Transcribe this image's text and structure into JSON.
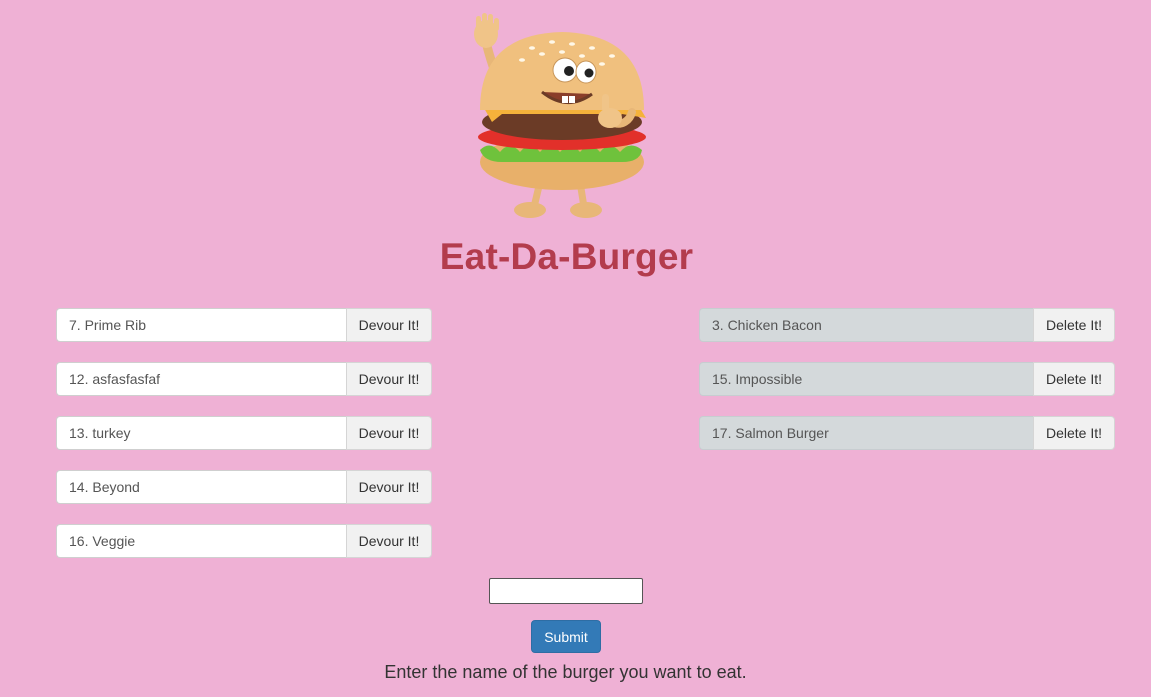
{
  "header": {
    "title": "Eat-Da-Burger"
  },
  "colors": {
    "background": "#efb1d5",
    "title": "#b33c4d",
    "submit": "#337ab7",
    "eaten_row": "#d4d9db"
  },
  "uneaten": {
    "button_label": "Devour It!",
    "items": [
      "7. Prime Rib",
      "12. asfasfasfaf",
      "13. turkey",
      "14. Beyond",
      "16. Veggie"
    ]
  },
  "devoured": {
    "button_label": "Delete It!",
    "items": [
      "3. Chicken Bacon",
      "15. Impossible",
      "17. Salmon Burger"
    ]
  },
  "form": {
    "input_value": "",
    "submit_label": "Submit",
    "instructions": "Enter the name of the burger you want to eat."
  },
  "mascot": {
    "icon": "burger-mascot-icon"
  }
}
